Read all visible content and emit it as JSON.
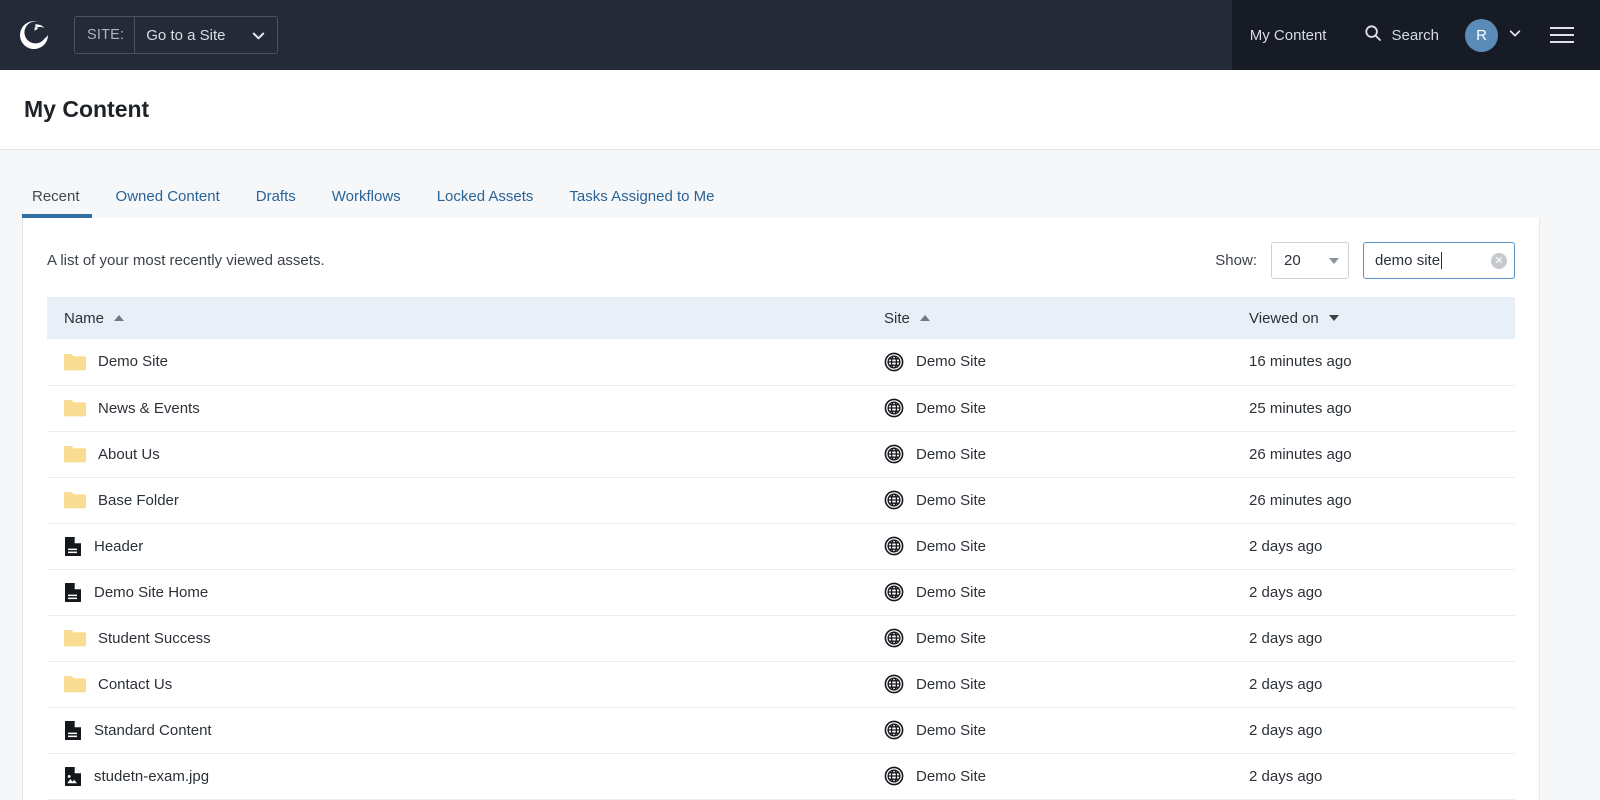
{
  "topbar": {
    "logo_icon": "squiz-crescent-logo",
    "site_selector": {
      "label": "SITE:",
      "value": "Go to a Site",
      "caret_icon": "chevron-down-icon"
    },
    "my_content_label": "My Content",
    "search_label": "Search",
    "search_icon": "search-icon",
    "avatar_initial": "R",
    "avatar_caret_icon": "chevron-down-icon",
    "menu_icon": "hamburger-menu-icon",
    "accent_color": "#5b8cb8",
    "panel_color": "#242a38",
    "bar_color": "#171b26"
  },
  "page": {
    "title": "My Content"
  },
  "tabs": [
    {
      "label": "Recent",
      "active": true
    },
    {
      "label": "Owned Content",
      "active": false
    },
    {
      "label": "Drafts",
      "active": false
    },
    {
      "label": "Workflows",
      "active": false
    },
    {
      "label": "Locked Assets",
      "active": false
    },
    {
      "label": "Tasks Assigned to Me",
      "active": false
    }
  ],
  "toolbar": {
    "description": "A list of your most recently viewed assets.",
    "show_label": "Show:",
    "show_value": "20",
    "show_caret_icon": "triangle-down-icon",
    "search_value": "demo site",
    "search_clear_icon": "clear-circle-icon"
  },
  "table": {
    "columns": [
      {
        "label": "Name",
        "sort": "asc",
        "sort_icon": "triangle-up-icon"
      },
      {
        "label": "Site",
        "sort": "asc",
        "sort_icon": "triangle-up-icon"
      },
      {
        "label": "Viewed on",
        "sort": "desc",
        "sort_icon": "triangle-down-icon"
      }
    ],
    "rows": [
      {
        "icon": "folder-icon",
        "name": "Demo Site",
        "site_icon": "globe-icon",
        "site": "Demo Site",
        "viewed": "16 minutes ago"
      },
      {
        "icon": "folder-icon",
        "name": "News & Events",
        "site_icon": "globe-icon",
        "site": "Demo Site",
        "viewed": "25 minutes ago"
      },
      {
        "icon": "folder-icon",
        "name": "About Us",
        "site_icon": "globe-icon",
        "site": "Demo Site",
        "viewed": "26 minutes ago"
      },
      {
        "icon": "folder-icon",
        "name": "Base Folder",
        "site_icon": "globe-icon",
        "site": "Demo Site",
        "viewed": "26 minutes ago"
      },
      {
        "icon": "document-icon",
        "name": "Header",
        "site_icon": "globe-icon",
        "site": "Demo Site",
        "viewed": "2 days ago"
      },
      {
        "icon": "document-icon",
        "name": "Demo Site Home",
        "site_icon": "globe-icon",
        "site": "Demo Site",
        "viewed": "2 days ago"
      },
      {
        "icon": "folder-icon",
        "name": "Student Success",
        "site_icon": "globe-icon",
        "site": "Demo Site",
        "viewed": "2 days ago"
      },
      {
        "icon": "folder-icon",
        "name": "Contact Us",
        "site_icon": "globe-icon",
        "site": "Demo Site",
        "viewed": "2 days ago"
      },
      {
        "icon": "document-icon",
        "name": "Standard Content",
        "site_icon": "globe-icon",
        "site": "Demo Site",
        "viewed": "2 days ago"
      },
      {
        "icon": "image-file-icon",
        "name": "studetn-exam.jpg",
        "site_icon": "globe-icon",
        "site": "Demo Site",
        "viewed": "2 days ago"
      }
    ],
    "folder_color": "#f7dc91",
    "header_bg": "#e8eff7"
  }
}
